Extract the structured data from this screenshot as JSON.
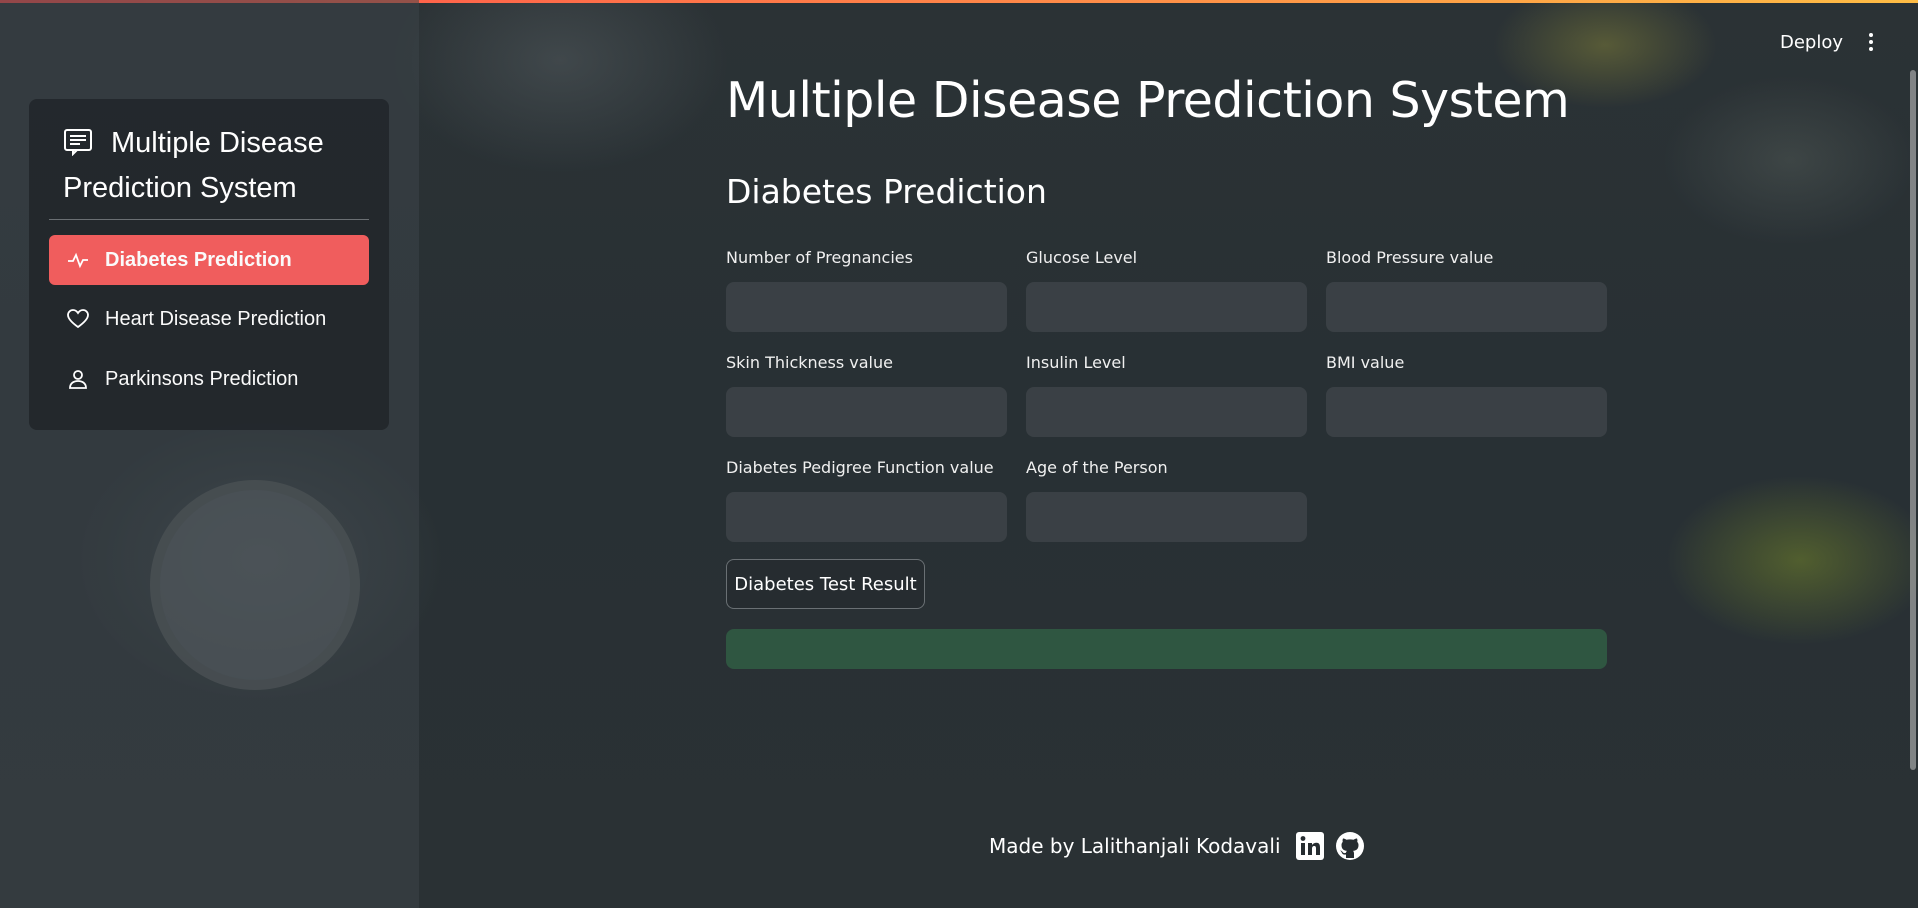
{
  "sidebar": {
    "title": "Multiple Disease Prediction System",
    "title_icon": "document-list-icon",
    "items": [
      {
        "label": "Diabetes Prediction",
        "icon": "activity-icon",
        "active": true
      },
      {
        "label": "Heart Disease Prediction",
        "icon": "heart-icon",
        "active": false
      },
      {
        "label": "Parkinsons Prediction",
        "icon": "person-icon",
        "active": false
      }
    ]
  },
  "header": {
    "deploy_label": "Deploy",
    "menu_icon": "kebab-menu-icon"
  },
  "main": {
    "title": "Multiple Disease Prediction System",
    "section_title": "Diabetes Prediction",
    "fields": [
      {
        "label": "Number of Pregnancies",
        "value": ""
      },
      {
        "label": "Glucose Level",
        "value": ""
      },
      {
        "label": "Blood Pressure value",
        "value": ""
      },
      {
        "label": "Skin Thickness value",
        "value": ""
      },
      {
        "label": "Insulin Level",
        "value": ""
      },
      {
        "label": "BMI value",
        "value": ""
      },
      {
        "label": "Diabetes Pedigree Function value",
        "value": ""
      },
      {
        "label": "Age of the Person",
        "value": ""
      }
    ],
    "result_button_label": "Diabetes Test Result",
    "result_text": ""
  },
  "footer": {
    "text": "Made by Lalithanjali Kodavali",
    "icons": [
      "linkedin-icon",
      "github-icon"
    ]
  },
  "colors": {
    "accent": "#f05d5d",
    "success_bar": "#2f5641",
    "input_bg": "#3a4045"
  }
}
